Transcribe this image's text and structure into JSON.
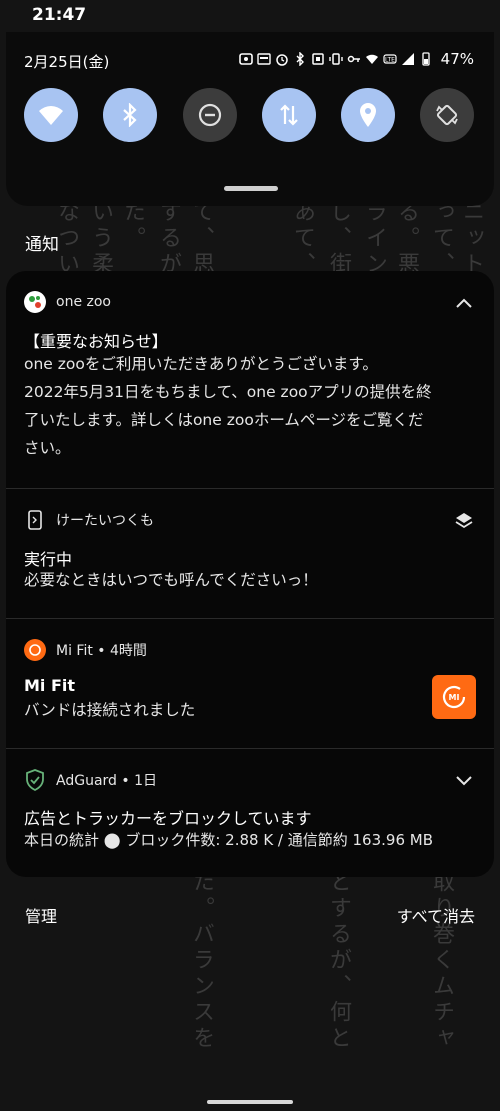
{
  "status_bar": {
    "time": "21:47"
  },
  "quick_settings": {
    "date": "2月25日(金)",
    "battery": "47%",
    "tiles": [
      {
        "name": "wifi",
        "active": true
      },
      {
        "name": "bluetooth",
        "active": true
      },
      {
        "name": "do-not-disturb",
        "active": false
      },
      {
        "name": "mobile-data",
        "active": true
      },
      {
        "name": "location",
        "active": true
      },
      {
        "name": "auto-rotate",
        "active": false
      }
    ]
  },
  "section_title": "通知",
  "notifications": [
    {
      "app": "one zoo",
      "title": "【重要なお知らせ】",
      "lines": [
        "one zooをご利用いただきありがとうございます。",
        "2022年5月31日をもちまして、one zooアプリの提供を終",
        "了いたします。詳しくはone zooホームページをご覧くだ",
        "さい。"
      ]
    },
    {
      "app": "けーたいつくも",
      "title": "実行中",
      "lines": [
        "必要なときはいつでも呼んでくださいっ！"
      ]
    },
    {
      "app": "Mi Fit • 4時間",
      "title": "Mi Fit",
      "lines": [
        "バンドは接続されました"
      ]
    },
    {
      "app": "AdGuard • 1日",
      "title": "広告とトラッカーをブロックしています",
      "lines": [
        "本日の統計 ⬤ ブロック件数: 2.88 K / 通信節約 163.96 MB"
      ]
    }
  ],
  "footer": {
    "manage": "管理",
    "clear_all": "すべて消去"
  },
  "background_text": [
    "ニットで",
    "って、そ",
    "る。悪夢",
    "ライン＝",
    "し、街路",
    "あて、一",
    "て、思わ",
    "するが、",
    "た。",
    "いう柔ら",
    "なついい",
    "取り巻くムチャ",
    "とするが、何と",
    "た。バランスを"
  ],
  "colors": {
    "tile_on": "#a8c4f2",
    "tile_off": "#3c3c3c",
    "card": "#070707",
    "mifit": "#ff6a13",
    "adguard": "#67b279"
  }
}
